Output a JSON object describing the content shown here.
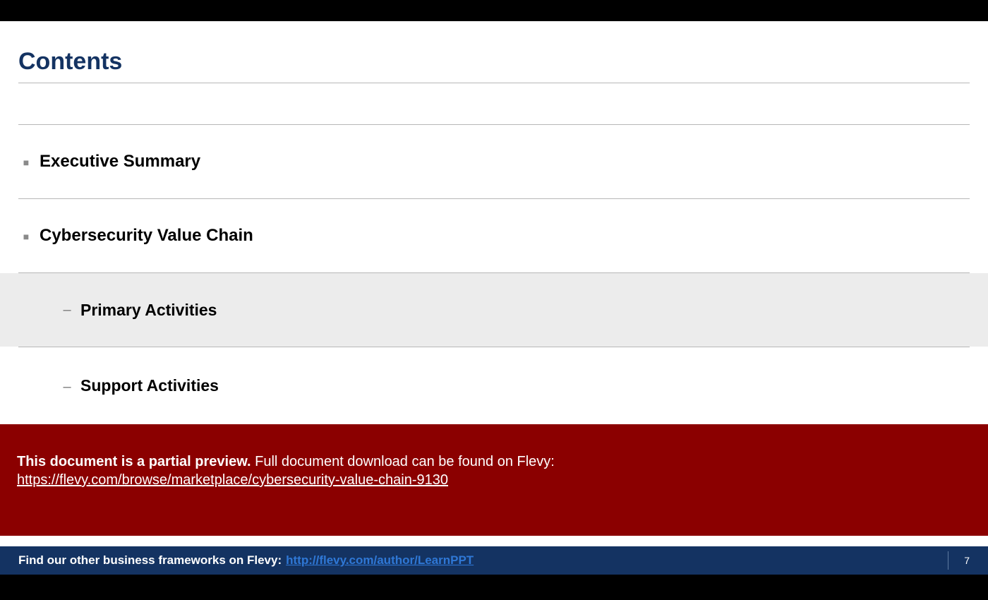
{
  "title": "Contents",
  "items": [
    {
      "label": "Executive Summary",
      "level": "top",
      "shaded": false
    },
    {
      "label": "Cybersecurity Value Chain",
      "level": "top",
      "shaded": false
    },
    {
      "label": "Primary Activities",
      "level": "sub",
      "shaded": true
    },
    {
      "label": "Support Activities",
      "level": "sub",
      "shaded": false
    }
  ],
  "banner": {
    "bold": "This document is a partial preview.",
    "rest": "  Full document download can be found on Flevy:",
    "url": "https://flevy.com/browse/marketplace/cybersecurity-value-chain-9130"
  },
  "footer": {
    "text": "Find our other business frameworks on Flevy:",
    "url": "http://flevy.com/author/LearnPPT",
    "page": "7"
  }
}
